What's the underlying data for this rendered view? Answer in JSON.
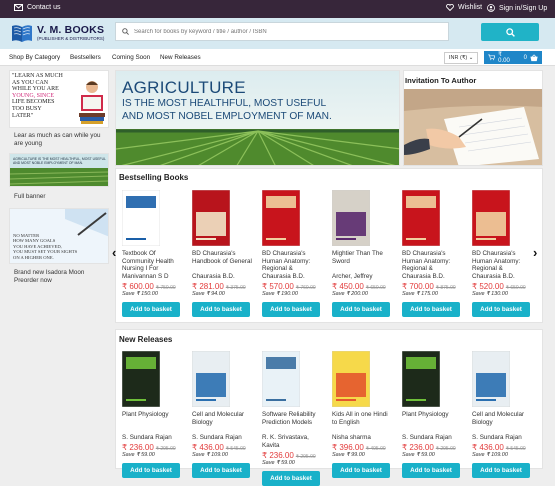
{
  "topbar": {
    "contact": "Contact us",
    "wishlist": "Wishlist",
    "signin": "Sign in/Sign Up"
  },
  "header": {
    "brand": "V. M. BOOKS",
    "brand_sub": "(PUBLISHER & DISTRIBUTORS)",
    "search_placeholder": "Search for books by keyword / title / author / ISBN"
  },
  "nav": {
    "items": [
      "Shop By Category",
      "Bestsellers",
      "Coming Soon",
      "New Releases"
    ],
    "currency": "INR (₹)",
    "cart_amount": "₹ 0.00",
    "cart_count": "0"
  },
  "sidebar": {
    "card1_lines": [
      "\"LEARN AS MUCH",
      "AS YOU CAN",
      "WHILE YOU ARE",
      "YOUNG, SINCE",
      "LIFE BECOMES",
      "TOO BUSY",
      "LATER\""
    ],
    "card1_caption": "Lear as much as can while you are young",
    "card2_text": "AGRICULTURE IS THE MOST HEALTHFUL, MOST USEFUL AND MOST NOBLE EMPLOYMENT OF MAN.",
    "card2_caption": "Full banner",
    "card3_lines": [
      "NO MATTER",
      "HOW MANY GOALS",
      "YOU HAVE ACHIEVED,",
      "YOU MUST SET YOUR SIGHTS",
      "ON A HIGHER ONE."
    ],
    "card3_caption": "Brand new Isadora Moon Preorder now"
  },
  "banner": {
    "line1": "AGRICULTURE",
    "line2": "IS THE MOST HEALTHFUL, MOST USEFUL",
    "line3": "AND MOST NOBEL EMPLOYMENT OF MAN."
  },
  "invite": {
    "title": "Invitation To Author"
  },
  "bestsellers": {
    "title": "Bestselling Books",
    "add_label": "Add to basket",
    "books": [
      {
        "title": "Textbook Of Community Health Nursing I For",
        "author": "Manivannan S D",
        "price": "₹ 600.00",
        "old": "₹ 750.00",
        "save": "Save ₹ 150.00",
        "cover": "#ffffff",
        "accent": "#1a5fa8"
      },
      {
        "title": "BD Chaurasia's Handbook of General",
        "author": "Chaurasia B.D.",
        "price": "₹ 281.00",
        "old": "₹ 375.00",
        "save": "Save ₹ 94.00",
        "cover": "#b8141c",
        "accent": "#f1e4c8"
      },
      {
        "title": "BD Chaurasia's Human Anatomy: Regional &",
        "author": "Chaurasia B.D.",
        "price": "₹ 570.00",
        "old": "₹ 760.00",
        "save": "Save ₹ 190.00",
        "cover": "#c8141c",
        "accent": "#f0d0a0"
      },
      {
        "title": "Mightier Than The Sword",
        "author": "Archer, Jeffrey",
        "price": "₹ 450.00",
        "old": "₹ 650.00",
        "save": "Save ₹ 200.00",
        "cover": "#d6d1c8",
        "accent": "#5b2a6e"
      },
      {
        "title": "BD Chaurasia's Human Anatomy: Regional &",
        "author": "Chaurasia B.D.",
        "price": "₹ 700.00",
        "old": "₹ 875.00",
        "save": "Save ₹ 175.00",
        "cover": "#c8141c",
        "accent": "#f0d0a0"
      },
      {
        "title": "BD Chaurasia's Human Anatomy: Regional &",
        "author": "Chaurasia B.D.",
        "price": "₹ 520.00",
        "old": "₹ 650.00",
        "save": "Save ₹ 130.00",
        "cover": "#c8141c",
        "accent": "#f0d0a0"
      }
    ]
  },
  "newreleases": {
    "title": "New Releases",
    "books": [
      {
        "title": "Plant Physiology",
        "author": "S. Sundara Rajan",
        "price": "₹ 236.00",
        "old": "₹ 295.00",
        "save": "Save ₹ 59.00",
        "cover": "#1d2a1a",
        "accent": "#6fbf3a"
      },
      {
        "title": "Cell and Molecular Biology",
        "author": "S. Sundara Rajan",
        "price": "₹ 436.00",
        "old": "₹ 545.00",
        "save": "Save ₹ 109.00",
        "cover": "#e8eef2",
        "accent": "#2a6fb0"
      },
      {
        "title": "Software Reliability Prediction Models",
        "author": "R. K. Srivastava, Kavita",
        "price": "₹ 236.00",
        "old": "₹ 295.00",
        "save": "Save ₹ 59.00",
        "cover": "#e9f2f7",
        "accent": "#3a6fa0"
      },
      {
        "title": "Kids All in one Hindi to English",
        "author": "Nisha sharma",
        "price": "₹ 396.00",
        "old": "₹ 495.00",
        "save": "Save ₹ 99.00",
        "cover": "#f6d94a",
        "accent": "#e4572e"
      },
      {
        "title": "Plant Physiology",
        "author": "S. Sundara Rajan",
        "price": "₹ 236.00",
        "old": "₹ 295.00",
        "save": "Save ₹ 59.00",
        "cover": "#1d2a1a",
        "accent": "#6fbf3a"
      },
      {
        "title": "Cell and Molecular Biology",
        "author": "S. Sundara Rajan",
        "price": "₹ 436.00",
        "old": "₹ 545.00",
        "save": "Save ₹ 109.00",
        "cover": "#e8eef2",
        "accent": "#2a6fb0"
      }
    ]
  }
}
